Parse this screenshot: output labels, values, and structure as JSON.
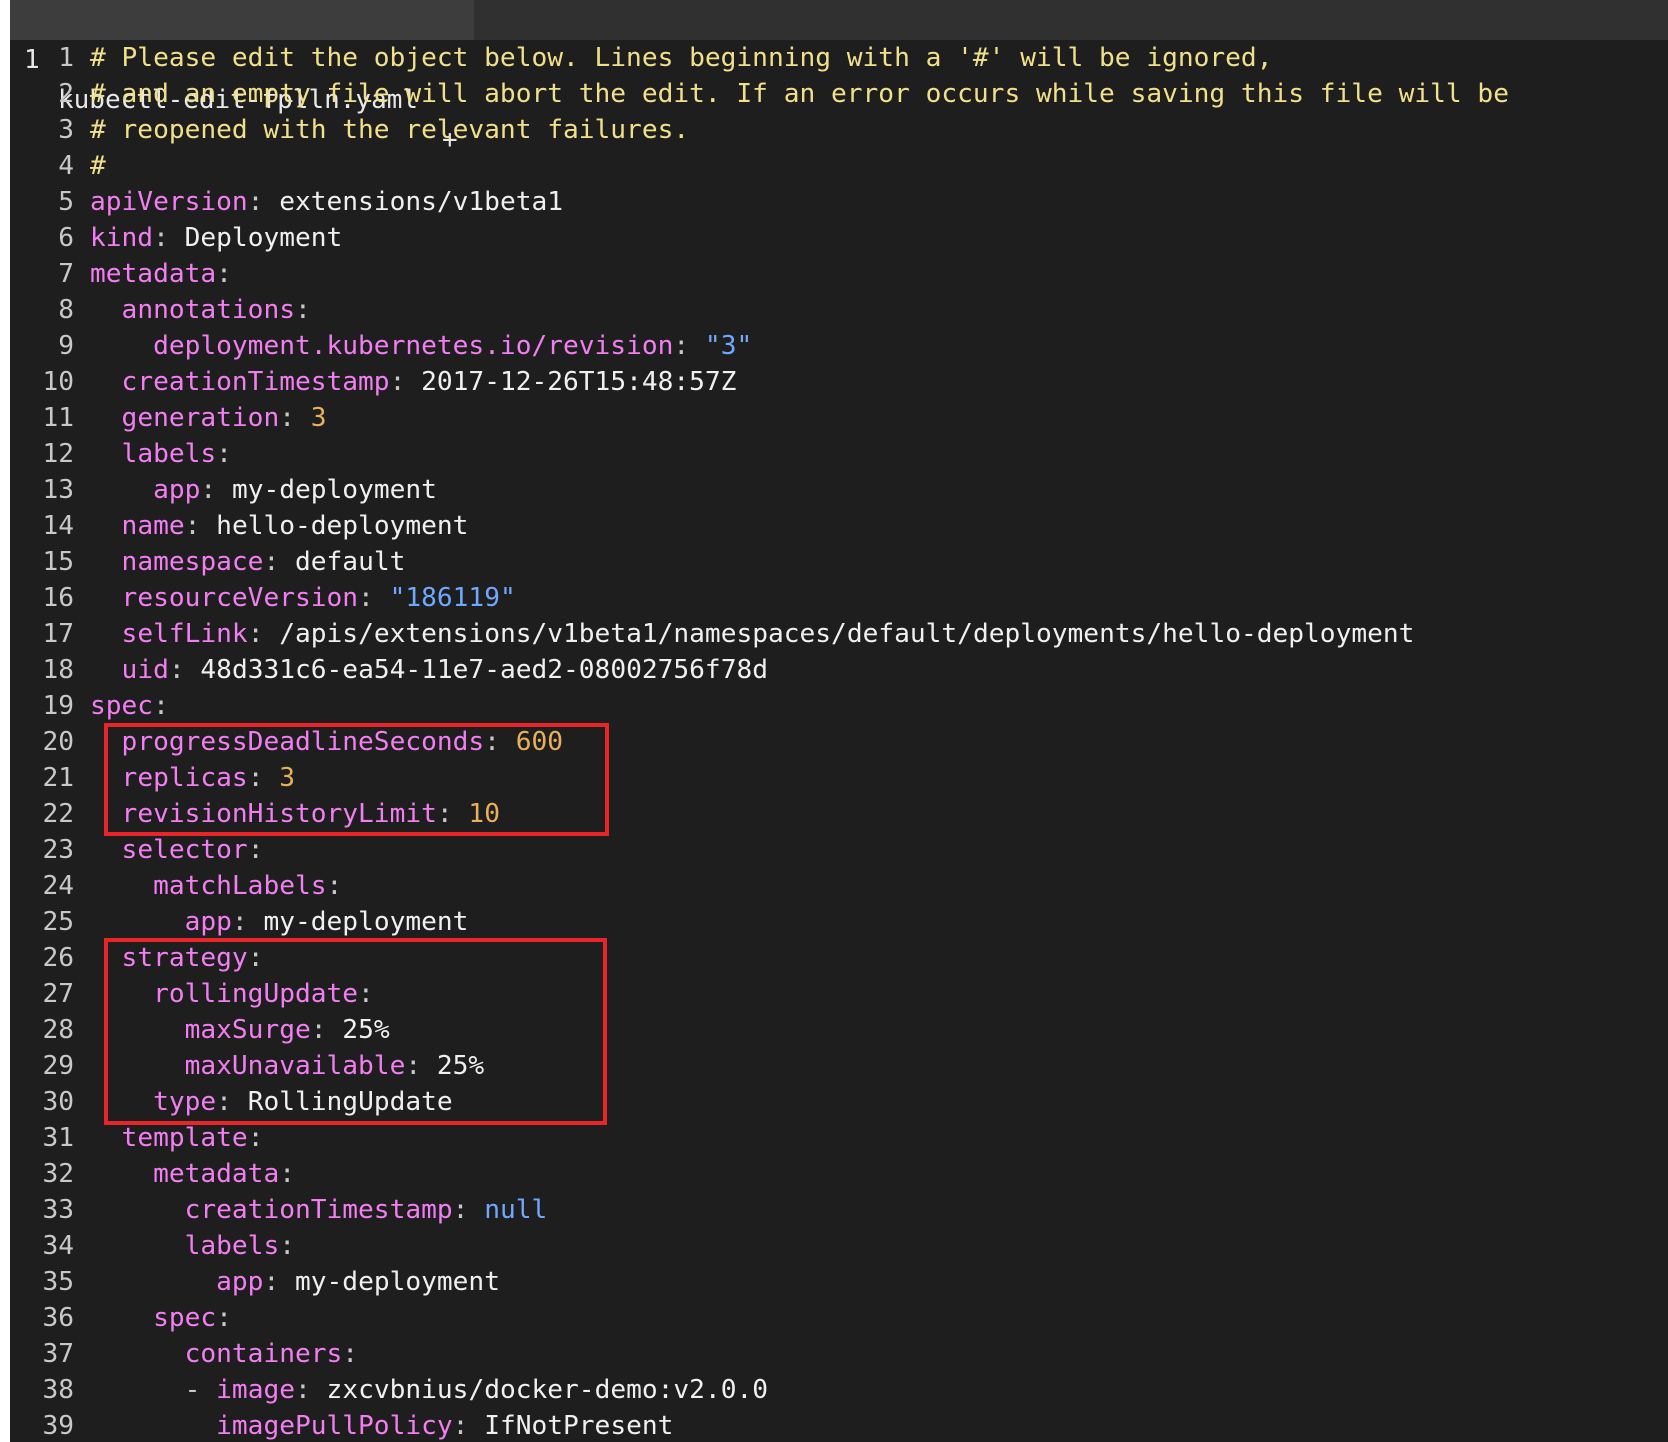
{
  "tab": {
    "number": "1",
    "filename": "kubectl-edit-fplln.yaml",
    "modified_marker": "+"
  },
  "colors": {
    "background": "#1e1e1e",
    "comment": "#f0e08a",
    "key": "#f37ef2",
    "string": "#6fa8ff",
    "number": "#e8b05a",
    "highlight_box": "#e8262a"
  },
  "lines": [
    {
      "n": "1",
      "parts": [
        {
          "t": "comment",
          "v": "# Please edit the object below. Lines beginning with a '#' will be ignored,"
        }
      ]
    },
    {
      "n": "2",
      "parts": [
        {
          "t": "comment",
          "v": "# and an empty file will abort the edit. If an error occurs while saving this file will be"
        }
      ]
    },
    {
      "n": "3",
      "parts": [
        {
          "t": "comment",
          "v": "# reopened with the relevant failures."
        }
      ]
    },
    {
      "n": "4",
      "parts": [
        {
          "t": "comment",
          "v": "#"
        }
      ]
    },
    {
      "n": "5",
      "parts": [
        {
          "t": "key",
          "v": "apiVersion"
        },
        {
          "t": "punct",
          "v": ": "
        },
        {
          "t": "plain",
          "v": "extensions/v1beta1"
        }
      ]
    },
    {
      "n": "6",
      "parts": [
        {
          "t": "key",
          "v": "kind"
        },
        {
          "t": "punct",
          "v": ": "
        },
        {
          "t": "plain",
          "v": "Deployment"
        }
      ]
    },
    {
      "n": "7",
      "parts": [
        {
          "t": "key",
          "v": "metadata"
        },
        {
          "t": "punct",
          "v": ":"
        }
      ]
    },
    {
      "n": "8",
      "parts": [
        {
          "t": "plain",
          "v": "  "
        },
        {
          "t": "key",
          "v": "annotations"
        },
        {
          "t": "punct",
          "v": ":"
        }
      ]
    },
    {
      "n": "9",
      "parts": [
        {
          "t": "plain",
          "v": "    "
        },
        {
          "t": "key",
          "v": "deployment.kubernetes.io/revision"
        },
        {
          "t": "punct",
          "v": ": "
        },
        {
          "t": "str",
          "v": "\"3\""
        }
      ]
    },
    {
      "n": "10",
      "parts": [
        {
          "t": "plain",
          "v": "  "
        },
        {
          "t": "key",
          "v": "creationTimestamp"
        },
        {
          "t": "punct",
          "v": ": "
        },
        {
          "t": "plain",
          "v": "2017-12-26T15:48:57Z"
        }
      ]
    },
    {
      "n": "11",
      "parts": [
        {
          "t": "plain",
          "v": "  "
        },
        {
          "t": "key",
          "v": "generation"
        },
        {
          "t": "punct",
          "v": ": "
        },
        {
          "t": "num",
          "v": "3"
        }
      ]
    },
    {
      "n": "12",
      "parts": [
        {
          "t": "plain",
          "v": "  "
        },
        {
          "t": "key",
          "v": "labels"
        },
        {
          "t": "punct",
          "v": ":"
        }
      ]
    },
    {
      "n": "13",
      "parts": [
        {
          "t": "plain",
          "v": "    "
        },
        {
          "t": "key",
          "v": "app"
        },
        {
          "t": "punct",
          "v": ": "
        },
        {
          "t": "plain",
          "v": "my-deployment"
        }
      ]
    },
    {
      "n": "14",
      "parts": [
        {
          "t": "plain",
          "v": "  "
        },
        {
          "t": "key",
          "v": "name"
        },
        {
          "t": "punct",
          "v": ": "
        },
        {
          "t": "plain",
          "v": "hello-deployment"
        }
      ]
    },
    {
      "n": "15",
      "parts": [
        {
          "t": "plain",
          "v": "  "
        },
        {
          "t": "key",
          "v": "namespace"
        },
        {
          "t": "punct",
          "v": ": "
        },
        {
          "t": "plain",
          "v": "default"
        }
      ]
    },
    {
      "n": "16",
      "parts": [
        {
          "t": "plain",
          "v": "  "
        },
        {
          "t": "key",
          "v": "resourceVersion"
        },
        {
          "t": "punct",
          "v": ": "
        },
        {
          "t": "str",
          "v": "\"186119\""
        }
      ]
    },
    {
      "n": "17",
      "parts": [
        {
          "t": "plain",
          "v": "  "
        },
        {
          "t": "key",
          "v": "selfLink"
        },
        {
          "t": "punct",
          "v": ": "
        },
        {
          "t": "plain",
          "v": "/apis/extensions/v1beta1/namespaces/default/deployments/hello-deployment"
        }
      ]
    },
    {
      "n": "18",
      "parts": [
        {
          "t": "plain",
          "v": "  "
        },
        {
          "t": "key",
          "v": "uid"
        },
        {
          "t": "punct",
          "v": ": "
        },
        {
          "t": "plain",
          "v": "48d331c6-ea54-11e7-aed2-08002756f78d"
        }
      ]
    },
    {
      "n": "19",
      "parts": [
        {
          "t": "key",
          "v": "spec"
        },
        {
          "t": "punct",
          "v": ":"
        }
      ]
    },
    {
      "n": "20",
      "parts": [
        {
          "t": "plain",
          "v": "  "
        },
        {
          "t": "key",
          "v": "progressDeadlineSeconds"
        },
        {
          "t": "punct",
          "v": ": "
        },
        {
          "t": "num",
          "v": "600"
        }
      ]
    },
    {
      "n": "21",
      "parts": [
        {
          "t": "plain",
          "v": "  "
        },
        {
          "t": "key",
          "v": "replicas"
        },
        {
          "t": "punct",
          "v": ": "
        },
        {
          "t": "num",
          "v": "3"
        }
      ]
    },
    {
      "n": "22",
      "parts": [
        {
          "t": "plain",
          "v": "  "
        },
        {
          "t": "key",
          "v": "revisionHistoryLimit"
        },
        {
          "t": "punct",
          "v": ": "
        },
        {
          "t": "num",
          "v": "10"
        }
      ]
    },
    {
      "n": "23",
      "parts": [
        {
          "t": "plain",
          "v": "  "
        },
        {
          "t": "key",
          "v": "selector"
        },
        {
          "t": "punct",
          "v": ":"
        }
      ]
    },
    {
      "n": "24",
      "parts": [
        {
          "t": "plain",
          "v": "    "
        },
        {
          "t": "key",
          "v": "matchLabels"
        },
        {
          "t": "punct",
          "v": ":"
        }
      ]
    },
    {
      "n": "25",
      "parts": [
        {
          "t": "plain",
          "v": "      "
        },
        {
          "t": "key",
          "v": "app"
        },
        {
          "t": "punct",
          "v": ": "
        },
        {
          "t": "plain",
          "v": "my-deployment"
        }
      ]
    },
    {
      "n": "26",
      "parts": [
        {
          "t": "plain",
          "v": "  "
        },
        {
          "t": "key",
          "v": "strategy"
        },
        {
          "t": "punct",
          "v": ":"
        }
      ]
    },
    {
      "n": "27",
      "parts": [
        {
          "t": "plain",
          "v": "    "
        },
        {
          "t": "key",
          "v": "rollingUpdate"
        },
        {
          "t": "punct",
          "v": ":"
        }
      ]
    },
    {
      "n": "28",
      "parts": [
        {
          "t": "plain",
          "v": "      "
        },
        {
          "t": "key",
          "v": "maxSurge"
        },
        {
          "t": "punct",
          "v": ": "
        },
        {
          "t": "plain",
          "v": "25%"
        }
      ]
    },
    {
      "n": "29",
      "parts": [
        {
          "t": "plain",
          "v": "      "
        },
        {
          "t": "key",
          "v": "maxUnavailable"
        },
        {
          "t": "punct",
          "v": ": "
        },
        {
          "t": "plain",
          "v": "25%"
        }
      ]
    },
    {
      "n": "30",
      "parts": [
        {
          "t": "plain",
          "v": "    "
        },
        {
          "t": "key",
          "v": "type"
        },
        {
          "t": "punct",
          "v": ": "
        },
        {
          "t": "plain",
          "v": "RollingUpdate"
        }
      ]
    },
    {
      "n": "31",
      "parts": [
        {
          "t": "plain",
          "v": "  "
        },
        {
          "t": "key",
          "v": "template"
        },
        {
          "t": "punct",
          "v": ":"
        }
      ]
    },
    {
      "n": "32",
      "parts": [
        {
          "t": "plain",
          "v": "    "
        },
        {
          "t": "key",
          "v": "metadata"
        },
        {
          "t": "punct",
          "v": ":"
        }
      ]
    },
    {
      "n": "33",
      "parts": [
        {
          "t": "plain",
          "v": "      "
        },
        {
          "t": "key",
          "v": "creationTimestamp"
        },
        {
          "t": "punct",
          "v": ": "
        },
        {
          "t": "null",
          "v": "null"
        }
      ]
    },
    {
      "n": "34",
      "parts": [
        {
          "t": "plain",
          "v": "      "
        },
        {
          "t": "key",
          "v": "labels"
        },
        {
          "t": "punct",
          "v": ":"
        }
      ]
    },
    {
      "n": "35",
      "parts": [
        {
          "t": "plain",
          "v": "        "
        },
        {
          "t": "key",
          "v": "app"
        },
        {
          "t": "punct",
          "v": ": "
        },
        {
          "t": "plain",
          "v": "my-deployment"
        }
      ]
    },
    {
      "n": "36",
      "parts": [
        {
          "t": "plain",
          "v": "    "
        },
        {
          "t": "key",
          "v": "spec"
        },
        {
          "t": "punct",
          "v": ":"
        }
      ]
    },
    {
      "n": "37",
      "parts": [
        {
          "t": "plain",
          "v": "      "
        },
        {
          "t": "key",
          "v": "containers"
        },
        {
          "t": "punct",
          "v": ":"
        }
      ]
    },
    {
      "n": "38",
      "parts": [
        {
          "t": "plain",
          "v": "      "
        },
        {
          "t": "punct",
          "v": "- "
        },
        {
          "t": "key",
          "v": "image"
        },
        {
          "t": "punct",
          "v": ": "
        },
        {
          "t": "plain",
          "v": "zxcvbnius/docker-demo:v2.0.0"
        }
      ]
    },
    {
      "n": "39",
      "parts": [
        {
          "t": "plain",
          "v": "        "
        },
        {
          "t": "key",
          "v": "imagePullPolicy"
        },
        {
          "t": "punct",
          "v": ": "
        },
        {
          "t": "plain",
          "v": "IfNotPresent"
        }
      ]
    }
  ]
}
